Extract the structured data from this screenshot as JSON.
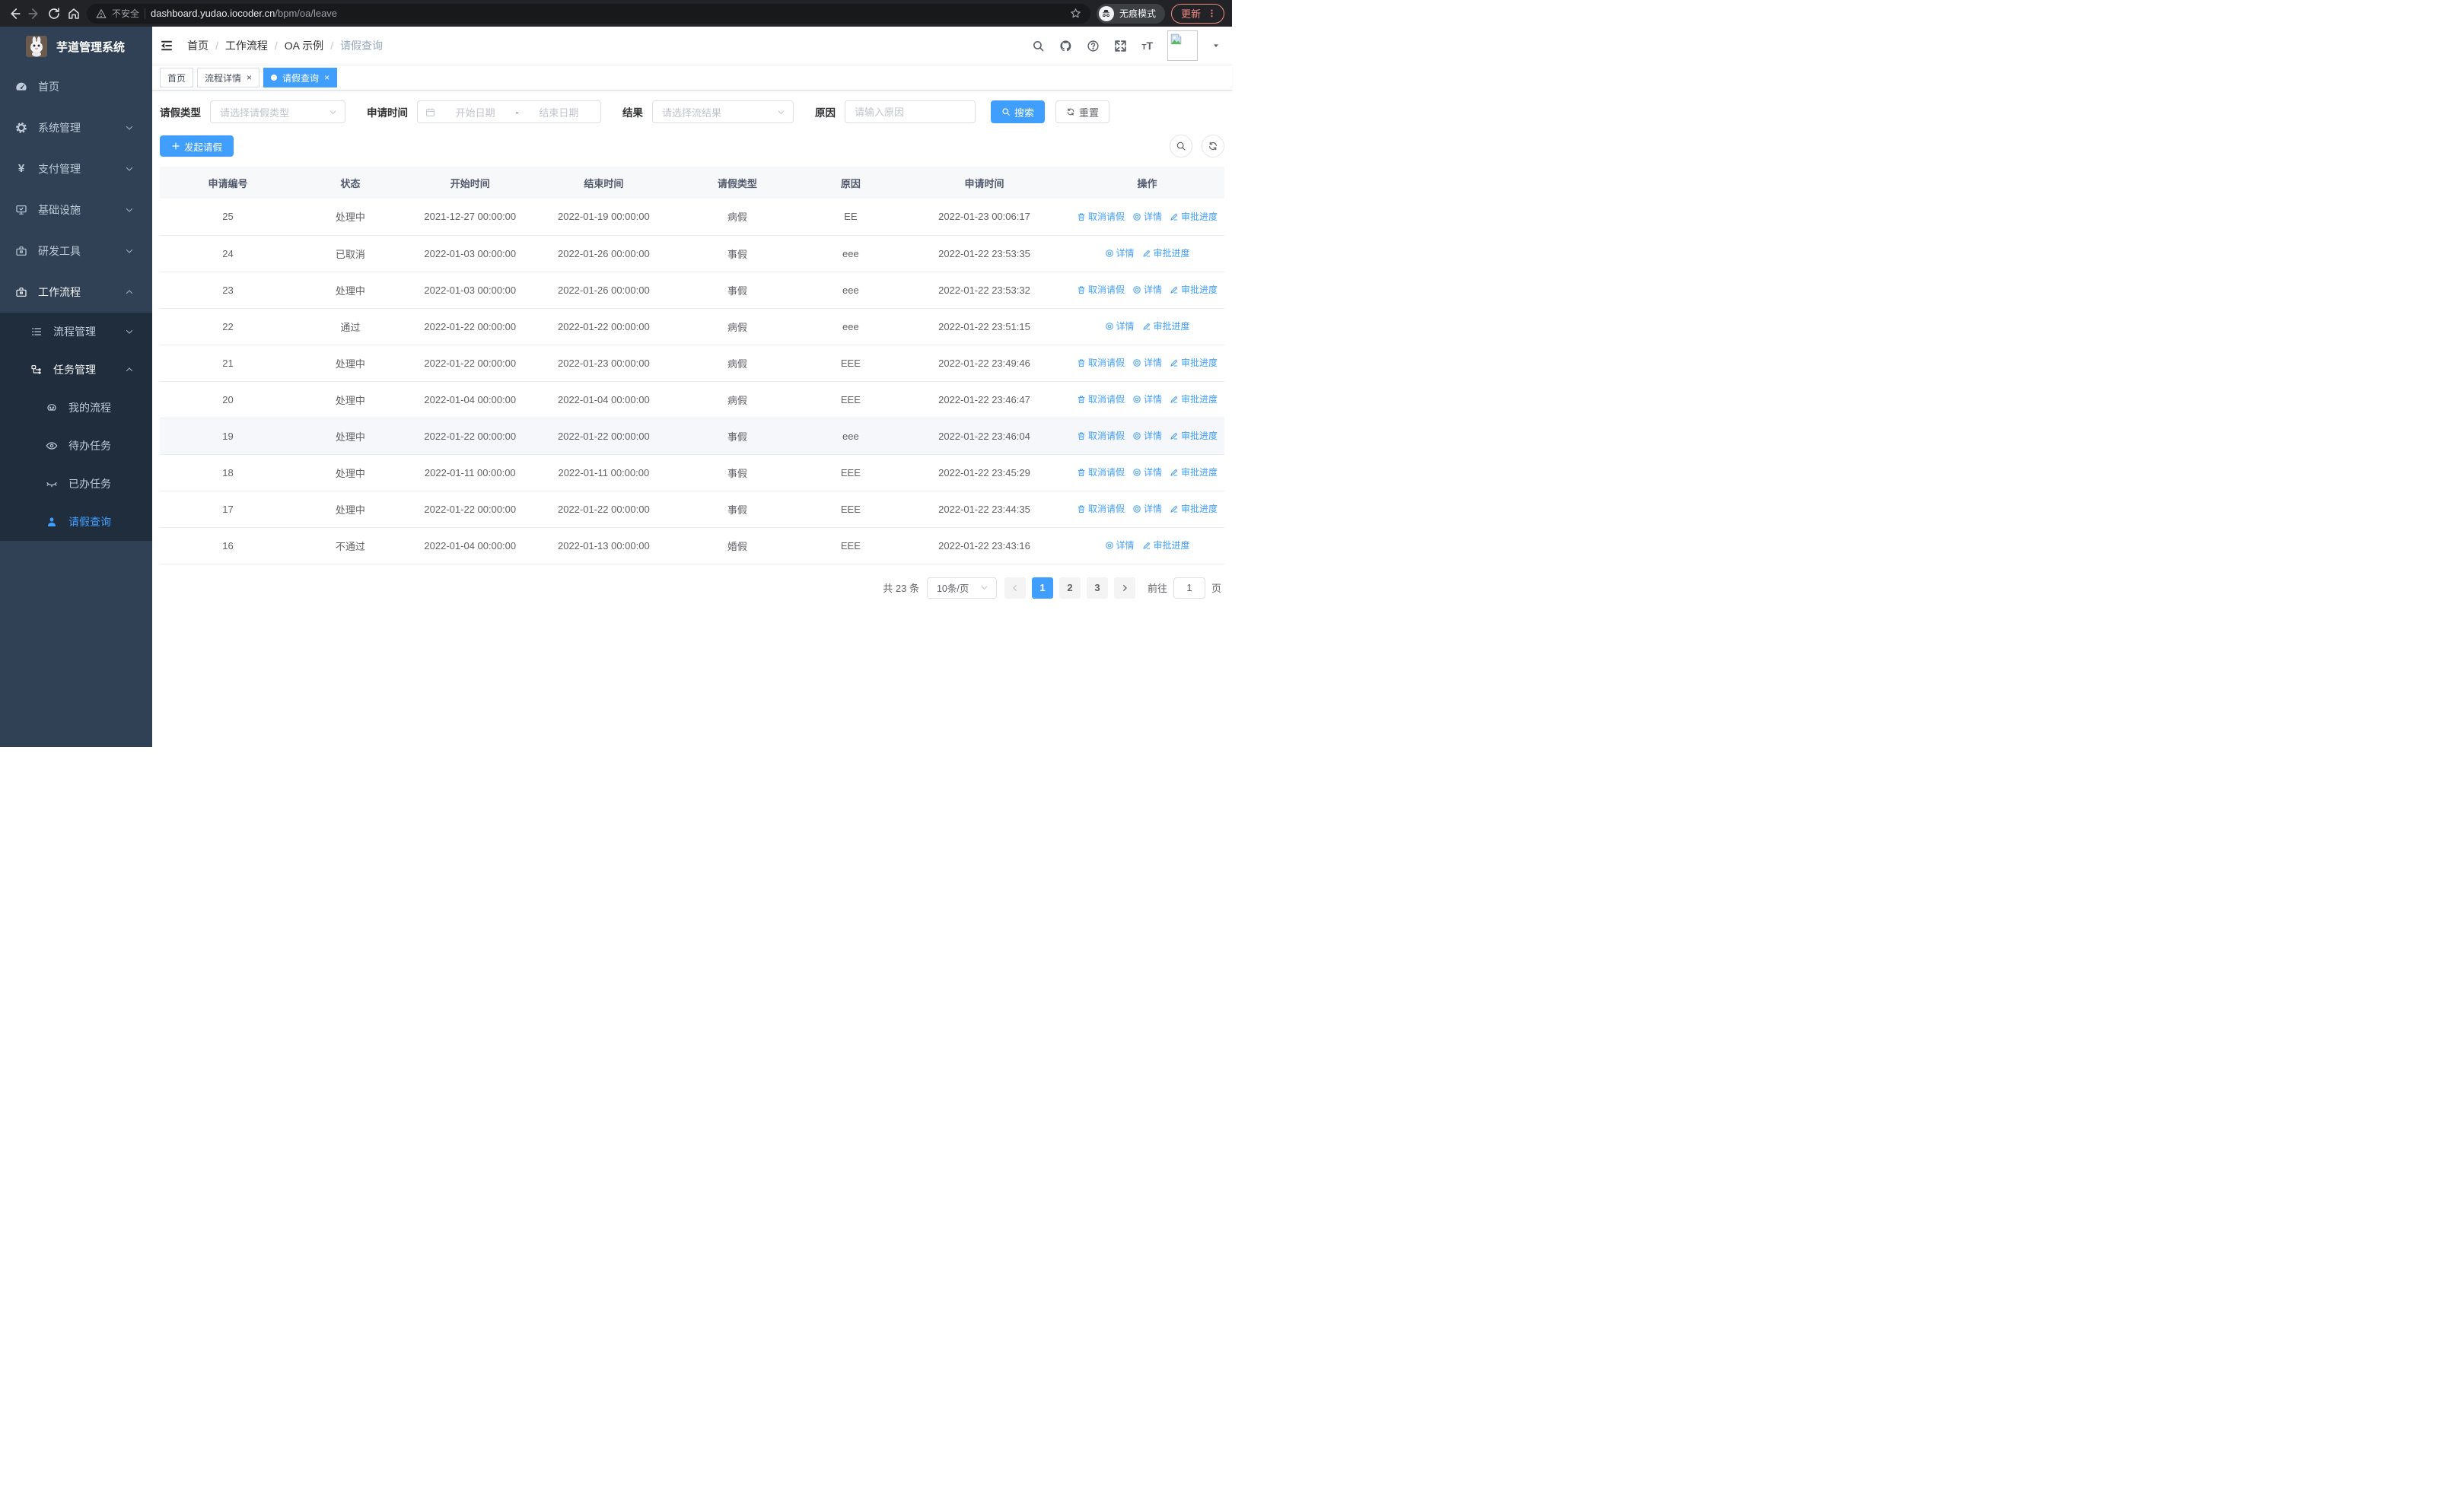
{
  "browser": {
    "security_label": "不安全",
    "url_host": "dashboard.yudao.iocoder.cn",
    "url_path": "/bpm/oa/leave",
    "incognito_label": "无痕模式",
    "update_label": "更新"
  },
  "sidebar": {
    "app_title": "芋道管理系统",
    "items": [
      {
        "label": "首页"
      },
      {
        "label": "系统管理"
      },
      {
        "label": "支付管理"
      },
      {
        "label": "基础设施"
      },
      {
        "label": "研发工具"
      },
      {
        "label": "工作流程"
      },
      {
        "label": "流程管理"
      },
      {
        "label": "任务管理"
      },
      {
        "label": "我的流程"
      },
      {
        "label": "待办任务"
      },
      {
        "label": "已办任务"
      },
      {
        "label": "请假查询"
      }
    ]
  },
  "breadcrumb": {
    "items": [
      "首页",
      "工作流程",
      "OA 示例",
      "请假查询"
    ]
  },
  "tabs": [
    {
      "label": "首页"
    },
    {
      "label": "流程详情"
    },
    {
      "label": "请假查询"
    }
  ],
  "filters": {
    "leave_type_label": "请假类型",
    "leave_type_placeholder": "请选择请假类型",
    "apply_time_label": "申请时间",
    "start_date_placeholder": "开始日期",
    "range_separator": "-",
    "end_date_placeholder": "结束日期",
    "result_label": "结果",
    "result_placeholder": "请选择流结果",
    "reason_label": "原因",
    "reason_placeholder": "请输入原因",
    "search_label": "搜索",
    "reset_label": "重置"
  },
  "toolbar": {
    "create_label": "发起请假"
  },
  "table": {
    "columns": [
      "申请编号",
      "状态",
      "开始时间",
      "结束时间",
      "请假类型",
      "原因",
      "申请时间",
      "操作"
    ],
    "actions": {
      "cancel": "取消请假",
      "detail": "详情",
      "progress": "审批进度"
    },
    "rows": [
      {
        "id": "25",
        "status": "处理中",
        "start": "2021-12-27 00:00:00",
        "end": "2022-01-19 00:00:00",
        "type": "病假",
        "reason": "EE",
        "applied": "2022-01-23 00:06:17"
      },
      {
        "id": "24",
        "status": "已取消",
        "start": "2022-01-03 00:00:00",
        "end": "2022-01-26 00:00:00",
        "type": "事假",
        "reason": "eee",
        "applied": "2022-01-22 23:53:35"
      },
      {
        "id": "23",
        "status": "处理中",
        "start": "2022-01-03 00:00:00",
        "end": "2022-01-26 00:00:00",
        "type": "事假",
        "reason": "eee",
        "applied": "2022-01-22 23:53:32"
      },
      {
        "id": "22",
        "status": "通过",
        "start": "2022-01-22 00:00:00",
        "end": "2022-01-22 00:00:00",
        "type": "病假",
        "reason": "eee",
        "applied": "2022-01-22 23:51:15"
      },
      {
        "id": "21",
        "status": "处理中",
        "start": "2022-01-22 00:00:00",
        "end": "2022-01-23 00:00:00",
        "type": "病假",
        "reason": "EEE",
        "applied": "2022-01-22 23:49:46"
      },
      {
        "id": "20",
        "status": "处理中",
        "start": "2022-01-04 00:00:00",
        "end": "2022-01-04 00:00:00",
        "type": "病假",
        "reason": "EEE",
        "applied": "2022-01-22 23:46:47"
      },
      {
        "id": "19",
        "status": "处理中",
        "start": "2022-01-22 00:00:00",
        "end": "2022-01-22 00:00:00",
        "type": "事假",
        "reason": "eee",
        "applied": "2022-01-22 23:46:04"
      },
      {
        "id": "18",
        "status": "处理中",
        "start": "2022-01-11 00:00:00",
        "end": "2022-01-11 00:00:00",
        "type": "事假",
        "reason": "EEE",
        "applied": "2022-01-22 23:45:29"
      },
      {
        "id": "17",
        "status": "处理中",
        "start": "2022-01-22 00:00:00",
        "end": "2022-01-22 00:00:00",
        "type": "事假",
        "reason": "EEE",
        "applied": "2022-01-22 23:44:35"
      },
      {
        "id": "16",
        "status": "不通过",
        "start": "2022-01-04 00:00:00",
        "end": "2022-01-13 00:00:00",
        "type": "婚假",
        "reason": "EEE",
        "applied": "2022-01-22 23:43:16"
      }
    ]
  },
  "pagination": {
    "total_label": "共 23 条",
    "page_size": "10条/页",
    "pages": [
      "1",
      "2",
      "3"
    ],
    "goto_label": "前往",
    "goto_value": "1",
    "page_suffix": "页"
  },
  "colors": {
    "accent": "#409EFF",
    "sidebar_bg": "#304156",
    "submenu_bg": "#1f2d3d",
    "update_pill": "#f28b82"
  }
}
